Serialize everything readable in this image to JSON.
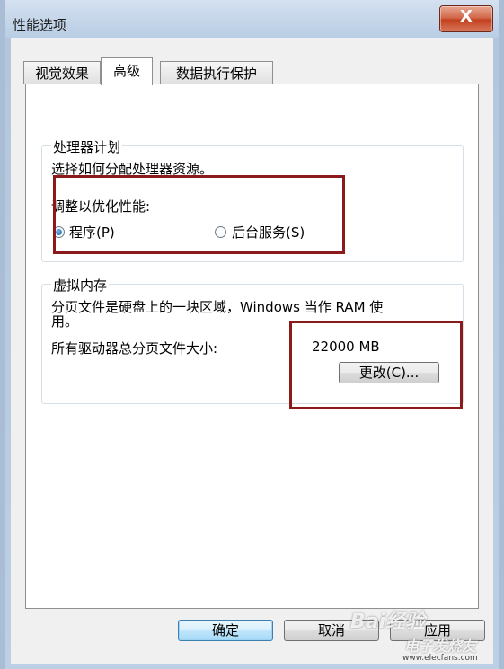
{
  "window": {
    "title": "性能选项",
    "close_label": "X"
  },
  "tabs": [
    {
      "label": "视觉效果",
      "active": false
    },
    {
      "label": "高级",
      "active": true
    },
    {
      "label": "数据执行保护",
      "active": false
    }
  ],
  "processor": {
    "legend": "处理器计划",
    "description": "选择如何分配处理器资源。",
    "adjust_label": "调整以优化性能:",
    "option_programs": "程序(P)",
    "option_background": "后台服务(S)",
    "selected": "option_programs"
  },
  "virtual_memory": {
    "legend": "虚拟内存",
    "description_line1": "分页文件是硬盘上的一块区域，Windows 当作 RAM 使",
    "description_line2": "用。",
    "total_label": "所有驱动器总分页文件大小:",
    "total_value": "22000 MB",
    "change_button": "更改(C)..."
  },
  "footer": {
    "ok_button": "确定",
    "cancel_button": "取消",
    "apply_button": "应用"
  },
  "watermark": {
    "baidu": "Bai",
    "baidu_suffix": "经验",
    "elecfans": "电子发烧友",
    "url": "www.elecfans.com"
  },
  "colors": {
    "highlight_box": "#8b1a1a",
    "close_button": "#c2401f",
    "title_bar": "#b9cde4"
  }
}
